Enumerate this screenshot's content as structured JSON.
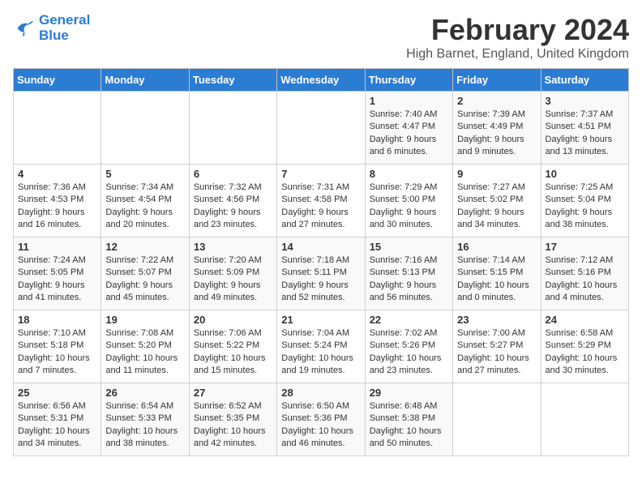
{
  "header": {
    "logo_line1": "General",
    "logo_line2": "Blue",
    "title": "February 2024",
    "subtitle": "High Barnet, England, United Kingdom"
  },
  "weekdays": [
    "Sunday",
    "Monday",
    "Tuesday",
    "Wednesday",
    "Thursday",
    "Friday",
    "Saturday"
  ],
  "weeks": [
    [
      {
        "day": "",
        "info": ""
      },
      {
        "day": "",
        "info": ""
      },
      {
        "day": "",
        "info": ""
      },
      {
        "day": "",
        "info": ""
      },
      {
        "day": "1",
        "info": "Sunrise: 7:40 AM\nSunset: 4:47 PM\nDaylight: 9 hours\nand 6 minutes."
      },
      {
        "day": "2",
        "info": "Sunrise: 7:39 AM\nSunset: 4:49 PM\nDaylight: 9 hours\nand 9 minutes."
      },
      {
        "day": "3",
        "info": "Sunrise: 7:37 AM\nSunset: 4:51 PM\nDaylight: 9 hours\nand 13 minutes."
      }
    ],
    [
      {
        "day": "4",
        "info": "Sunrise: 7:36 AM\nSunset: 4:53 PM\nDaylight: 9 hours\nand 16 minutes."
      },
      {
        "day": "5",
        "info": "Sunrise: 7:34 AM\nSunset: 4:54 PM\nDaylight: 9 hours\nand 20 minutes."
      },
      {
        "day": "6",
        "info": "Sunrise: 7:32 AM\nSunset: 4:56 PM\nDaylight: 9 hours\nand 23 minutes."
      },
      {
        "day": "7",
        "info": "Sunrise: 7:31 AM\nSunset: 4:58 PM\nDaylight: 9 hours\nand 27 minutes."
      },
      {
        "day": "8",
        "info": "Sunrise: 7:29 AM\nSunset: 5:00 PM\nDaylight: 9 hours\nand 30 minutes."
      },
      {
        "day": "9",
        "info": "Sunrise: 7:27 AM\nSunset: 5:02 PM\nDaylight: 9 hours\nand 34 minutes."
      },
      {
        "day": "10",
        "info": "Sunrise: 7:25 AM\nSunset: 5:04 PM\nDaylight: 9 hours\nand 38 minutes."
      }
    ],
    [
      {
        "day": "11",
        "info": "Sunrise: 7:24 AM\nSunset: 5:05 PM\nDaylight: 9 hours\nand 41 minutes."
      },
      {
        "day": "12",
        "info": "Sunrise: 7:22 AM\nSunset: 5:07 PM\nDaylight: 9 hours\nand 45 minutes."
      },
      {
        "day": "13",
        "info": "Sunrise: 7:20 AM\nSunset: 5:09 PM\nDaylight: 9 hours\nand 49 minutes."
      },
      {
        "day": "14",
        "info": "Sunrise: 7:18 AM\nSunset: 5:11 PM\nDaylight: 9 hours\nand 52 minutes."
      },
      {
        "day": "15",
        "info": "Sunrise: 7:16 AM\nSunset: 5:13 PM\nDaylight: 9 hours\nand 56 minutes."
      },
      {
        "day": "16",
        "info": "Sunrise: 7:14 AM\nSunset: 5:15 PM\nDaylight: 10 hours\nand 0 minutes."
      },
      {
        "day": "17",
        "info": "Sunrise: 7:12 AM\nSunset: 5:16 PM\nDaylight: 10 hours\nand 4 minutes."
      }
    ],
    [
      {
        "day": "18",
        "info": "Sunrise: 7:10 AM\nSunset: 5:18 PM\nDaylight: 10 hours\nand 7 minutes."
      },
      {
        "day": "19",
        "info": "Sunrise: 7:08 AM\nSunset: 5:20 PM\nDaylight: 10 hours\nand 11 minutes."
      },
      {
        "day": "20",
        "info": "Sunrise: 7:06 AM\nSunset: 5:22 PM\nDaylight: 10 hours\nand 15 minutes."
      },
      {
        "day": "21",
        "info": "Sunrise: 7:04 AM\nSunset: 5:24 PM\nDaylight: 10 hours\nand 19 minutes."
      },
      {
        "day": "22",
        "info": "Sunrise: 7:02 AM\nSunset: 5:26 PM\nDaylight: 10 hours\nand 23 minutes."
      },
      {
        "day": "23",
        "info": "Sunrise: 7:00 AM\nSunset: 5:27 PM\nDaylight: 10 hours\nand 27 minutes."
      },
      {
        "day": "24",
        "info": "Sunrise: 6:58 AM\nSunset: 5:29 PM\nDaylight: 10 hours\nand 30 minutes."
      }
    ],
    [
      {
        "day": "25",
        "info": "Sunrise: 6:56 AM\nSunset: 5:31 PM\nDaylight: 10 hours\nand 34 minutes."
      },
      {
        "day": "26",
        "info": "Sunrise: 6:54 AM\nSunset: 5:33 PM\nDaylight: 10 hours\nand 38 minutes."
      },
      {
        "day": "27",
        "info": "Sunrise: 6:52 AM\nSunset: 5:35 PM\nDaylight: 10 hours\nand 42 minutes."
      },
      {
        "day": "28",
        "info": "Sunrise: 6:50 AM\nSunset: 5:36 PM\nDaylight: 10 hours\nand 46 minutes."
      },
      {
        "day": "29",
        "info": "Sunrise: 6:48 AM\nSunset: 5:38 PM\nDaylight: 10 hours\nand 50 minutes."
      },
      {
        "day": "",
        "info": ""
      },
      {
        "day": "",
        "info": ""
      }
    ]
  ]
}
